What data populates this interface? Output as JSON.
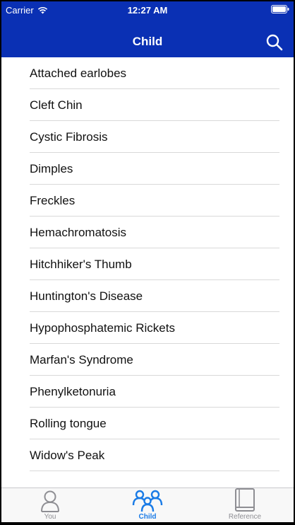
{
  "status_bar": {
    "carrier": "Carrier",
    "time": "12:27 AM"
  },
  "nav": {
    "title": "Child",
    "search_icon": "search-icon"
  },
  "list": {
    "items": [
      "Attached earlobes",
      "Cleft Chin",
      "Cystic Fibrosis",
      "Dimples",
      "Freckles",
      "Hemachromatosis",
      "Hitchhiker's Thumb",
      "Huntington's Disease",
      "Hypophosphatemic Rickets",
      "Marfan's Syndrome",
      "Phenylketonuria",
      "Rolling tongue",
      "Widow's Peak"
    ]
  },
  "tab_bar": {
    "tabs": [
      {
        "label": "You",
        "icon": "person-icon",
        "active": false
      },
      {
        "label": "Child",
        "icon": "family-icon",
        "active": true
      },
      {
        "label": "Reference",
        "icon": "book-icon",
        "active": false
      }
    ]
  },
  "colors": {
    "header": "#0a30b4",
    "accent": "#1a7be6",
    "inactive": "#8e8e93"
  }
}
